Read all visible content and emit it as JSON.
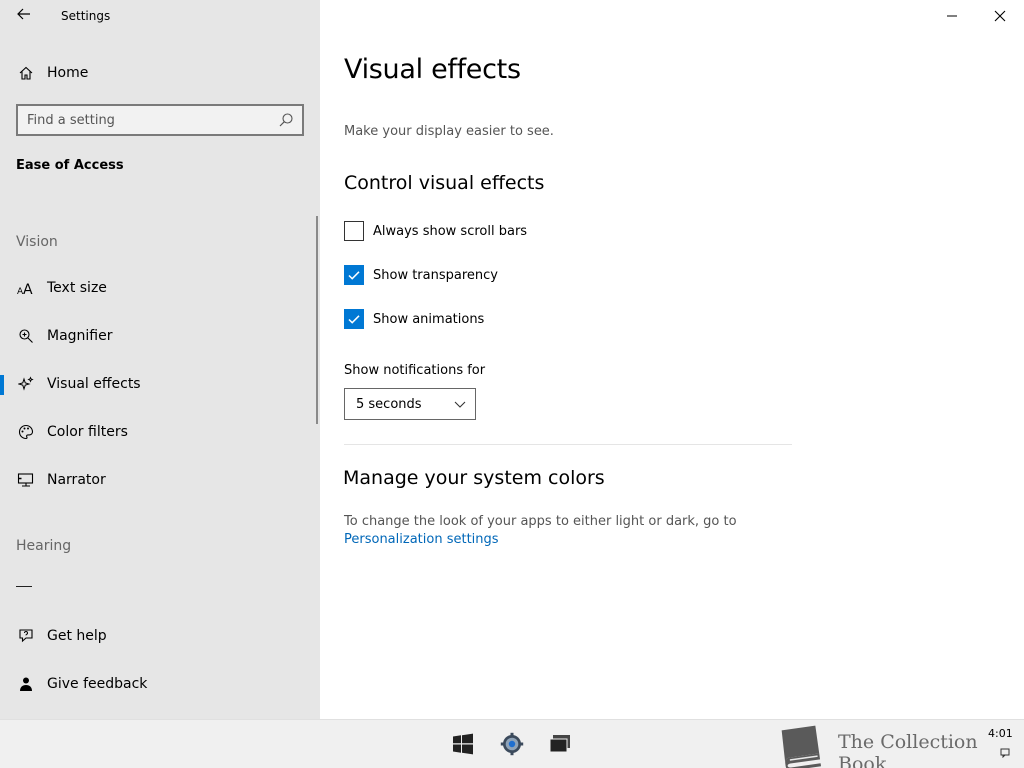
{
  "window": {
    "title": "Settings",
    "minimize_glyph": "—",
    "close_glyph": "✕"
  },
  "sidebar": {
    "home_label": "Home",
    "search_placeholder": "Find a setting",
    "category_title": "Ease of Access",
    "groups": [
      {
        "label": "Vision",
        "items": [
          {
            "label": "Text size",
            "icon": "text-size-icon"
          },
          {
            "label": "Magnifier",
            "icon": "magnifier-icon"
          },
          {
            "label": "Visual effects",
            "icon": "sparkle-icon",
            "active": true
          },
          {
            "label": "Color filters",
            "icon": "palette-icon"
          },
          {
            "label": "Narrator",
            "icon": "narrator-icon"
          }
        ]
      },
      {
        "label": "Hearing",
        "items": []
      }
    ],
    "footer_items": [
      {
        "label": "Get help",
        "icon": "help-icon"
      },
      {
        "label": "Give feedback",
        "icon": "feedback-icon"
      }
    ]
  },
  "main": {
    "page_title": "Visual effects",
    "description": "Make your display easier to see.",
    "control_heading": "Control visual effects",
    "checkboxes": [
      {
        "label": "Always show scroll bars",
        "checked": false
      },
      {
        "label": "Show transparency",
        "checked": true
      },
      {
        "label": "Show animations",
        "checked": true
      }
    ],
    "notifications_label": "Show notifications for",
    "notifications_value": "5 seconds",
    "colors_heading": "Manage your system colors",
    "colors_description": "To change the look of your apps to either light or dark, go to",
    "colors_link": "Personalization settings"
  },
  "taskbar": {
    "icons": [
      "windows-start-icon",
      "settings-gear-icon",
      "task-view-icon"
    ],
    "watermark_text": "The Collection Book",
    "clock": "4:01"
  },
  "colors": {
    "accent": "#0078d4",
    "link": "#0067b8",
    "sidebar_bg": "#e6e6e6"
  }
}
